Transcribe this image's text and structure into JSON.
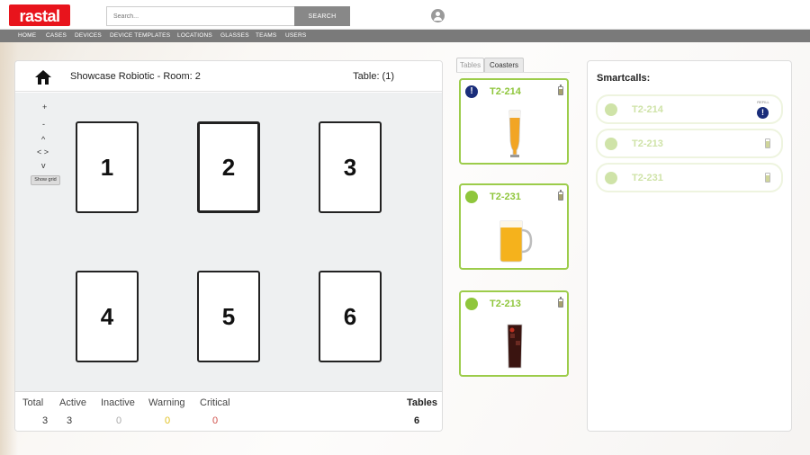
{
  "header": {
    "logo_text": "rastal",
    "search_placeholder": "Search...",
    "search_button": "SEARCH"
  },
  "nav": {
    "items": [
      "HOME",
      "CASES",
      "DEVICES",
      "DEVICE TEMPLATES",
      "LOCATIONS",
      "GLASSES",
      "TEAMS",
      "USERS"
    ]
  },
  "room": {
    "title": "Showcase Robiotic - Room: 2",
    "table_label": "Table: (1)",
    "controls": {
      "plus": "+",
      "minus": "-",
      "up": "^",
      "left_right": "< >",
      "down": "v",
      "show_grid": "Show grid"
    },
    "tables": [
      "1",
      "2",
      "3",
      "4",
      "5",
      "6"
    ],
    "selected_table": "2"
  },
  "stats": {
    "total_label": "Total",
    "total_value": "3",
    "active_label": "Active",
    "active_value": "3",
    "inactive_label": "Inactive",
    "inactive_value": "0",
    "warning_label": "Warning",
    "warning_value": "0",
    "critical_label": "Critical",
    "critical_value": "0",
    "tables_label": "Tables",
    "tables_value": "6"
  },
  "tabs": {
    "tables": "Tables",
    "coasters": "Coasters",
    "active": "Coasters"
  },
  "coasters": [
    {
      "name": "T2-214",
      "status": "alert",
      "status_icon": "exclamation",
      "glass": "wheat-beer-glass"
    },
    {
      "name": "T2-231",
      "status": "active",
      "glass": "beer-mug"
    },
    {
      "name": "T2-213",
      "status": "active",
      "glass": "cola-glass"
    }
  ],
  "smartcalls": {
    "title": "Smartcalls:",
    "items": [
      {
        "name": "T2-214",
        "icon": "refill-alert-icon",
        "icon_label": "REFILL"
      },
      {
        "name": "T2-213",
        "icon": "battery-icon"
      },
      {
        "name": "T2-231",
        "icon": "battery-icon"
      }
    ]
  },
  "colors": {
    "brand_red": "#e8141c",
    "nav_gray": "#7a7a7a",
    "active_green": "#8fc63c",
    "alert_blue": "#1a2d7a",
    "warning_yellow": "#e0c020",
    "critical_red": "#d0504a",
    "inactive_gray": "#aaaaaa"
  }
}
